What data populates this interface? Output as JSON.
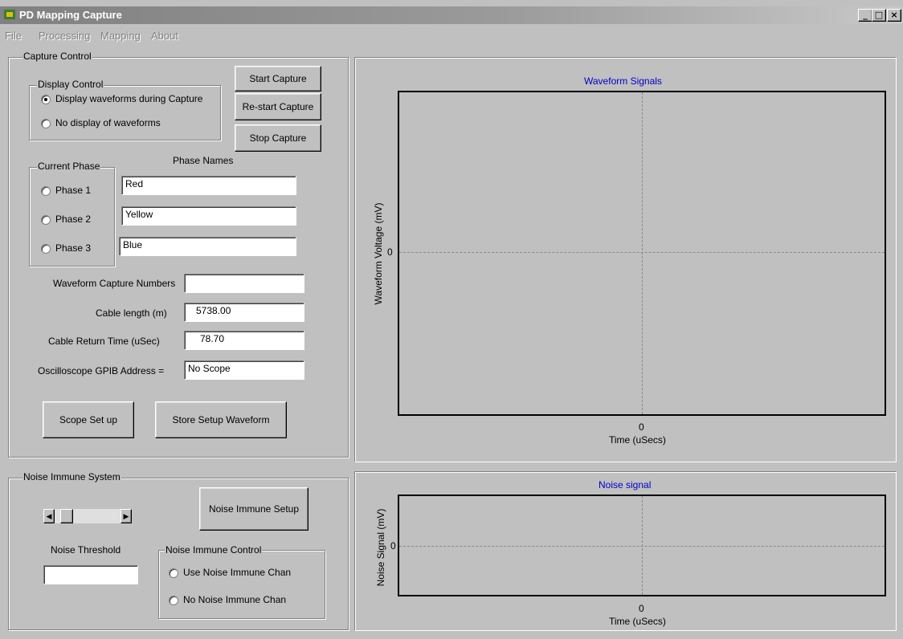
{
  "window": {
    "title": "PD Mapping Capture",
    "min_glyph": "_",
    "max_glyph": "□",
    "close_glyph": "×"
  },
  "menu": [
    "File",
    "Processing",
    "Mapping",
    "About"
  ],
  "capture_control": {
    "legend": "Capture Control",
    "display_control": {
      "legend": "Display Control",
      "options": [
        "Display waveforms during Capture",
        "No display of waveforms"
      ],
      "selected": 0
    },
    "buttons": {
      "start": "Start Capture",
      "restart": "Re-start Capture",
      "stop": "Stop Capture"
    },
    "current_phase": {
      "legend": "Current Phase",
      "options": [
        "Phase 1",
        "Phase 2",
        "Phase 3"
      ]
    },
    "phase_names_label": "Phase Names",
    "phase_names": [
      "Red",
      "Yellow",
      "Blue"
    ],
    "fields": {
      "capture_numbers": {
        "label": "Waveform Capture Numbers",
        "value": ""
      },
      "cable_length": {
        "label": "Cable length (m)",
        "value": "5738.00"
      },
      "return_time": {
        "label": "Cable Return Time (uSec)",
        "value": "78.70"
      },
      "gpib": {
        "label": "Oscilloscope GPIB Address =",
        "value": "No Scope"
      }
    },
    "scope_setup": "Scope Set up",
    "store_setup": "Store Setup Waveform"
  },
  "noise_system": {
    "legend": "Noise Immune System",
    "setup_button": "Noise Immune Setup",
    "threshold_label": "Noise Threshold",
    "threshold_value": "",
    "control": {
      "legend": "Noise Immune Control",
      "options": [
        "Use Noise Immune Chan",
        "No Noise Immune Chan"
      ]
    },
    "slider_level": 0.1
  },
  "waveform_plot": {
    "title": "Waveform Signals",
    "ylabel": "Waveform Voltage (mV)",
    "xlabel": "Time (uSecs)",
    "x_tick": "0",
    "y_tick": "0"
  },
  "noise_plot": {
    "title": "Noise signal",
    "ylabel": "Noise Signal (mV)",
    "xlabel": "Time (uSecs)",
    "x_tick": "0",
    "y_tick": "0"
  },
  "colors": {
    "plot_title": "#0000cc",
    "face": "#c0c0c0"
  }
}
